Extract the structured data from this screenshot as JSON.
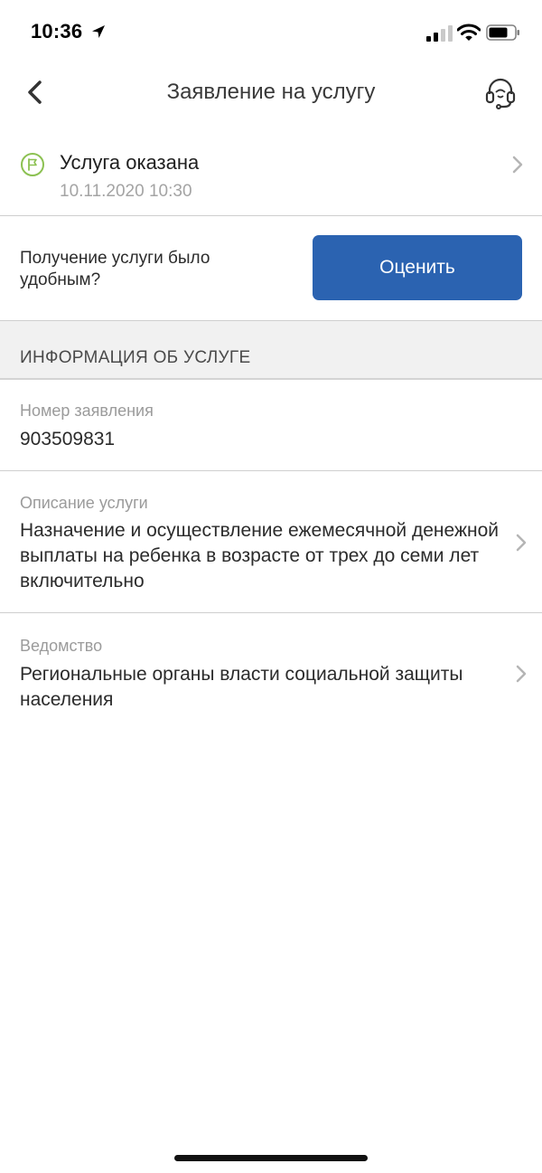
{
  "status_bar": {
    "time": "10:36"
  },
  "nav": {
    "title": "Заявление на услугу"
  },
  "status": {
    "title": "Услуга оказана",
    "date": "10.11.2020 10:30",
    "icon": "flag-icon",
    "accent_color": "#8cc152"
  },
  "rating": {
    "question": "Получение услуги было удобным?",
    "button_label": "Оценить",
    "button_color": "#2b63b1"
  },
  "section": {
    "header": "ИНФОРМАЦИЯ ОБ УСЛУГЕ"
  },
  "fields": [
    {
      "label": "Номер заявления",
      "value": "903509831"
    },
    {
      "label": "Описание услуги",
      "value": "Назначение и осуществление ежемесячной денежной выплаты на ребенка в возрасте от трех до семи лет включительно"
    },
    {
      "label": "Ведомство",
      "value": "Региональные органы власти социальной защиты населения"
    }
  ]
}
